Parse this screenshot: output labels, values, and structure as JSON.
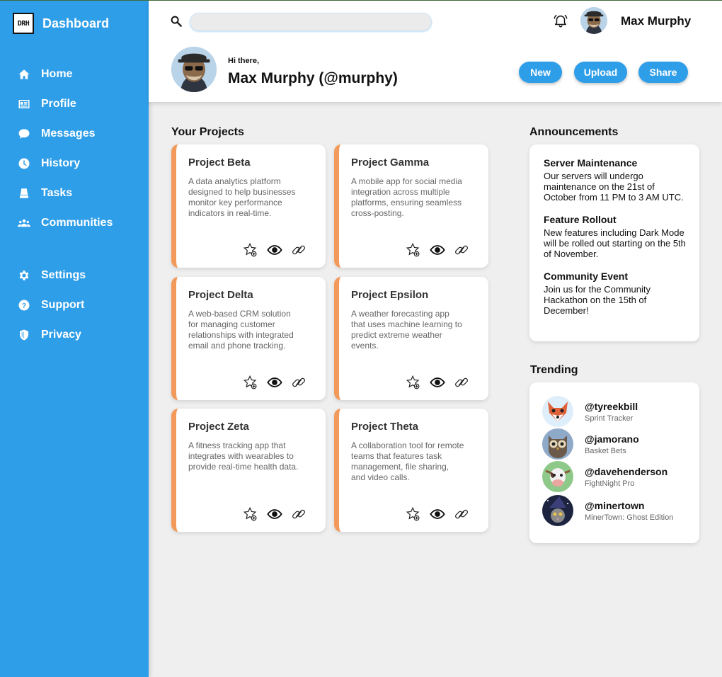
{
  "sidebar": {
    "logo": "DRH",
    "title": "Dashboard",
    "main_items": [
      {
        "label": "Home",
        "icon": "home-icon"
      },
      {
        "label": "Profile",
        "icon": "id-card-icon"
      },
      {
        "label": "Messages",
        "icon": "chat-bubble-icon"
      },
      {
        "label": "History",
        "icon": "clock-icon"
      },
      {
        "label": "Tasks",
        "icon": "tasks-icon"
      },
      {
        "label": "Communities",
        "icon": "people-icon"
      }
    ],
    "secondary_items": [
      {
        "label": "Settings",
        "icon": "gear-icon"
      },
      {
        "label": "Support",
        "icon": "help-icon"
      },
      {
        "label": "Privacy",
        "icon": "shield-icon"
      }
    ]
  },
  "header": {
    "search_placeholder": "",
    "search_value": "",
    "user_name": "Max Murphy",
    "greeting": "Hi there,",
    "handle": "Max Murphy (@murphy)",
    "buttons": {
      "new": "New",
      "upload": "Upload",
      "share": "Share"
    }
  },
  "projects": {
    "title": "Your Projects",
    "items": [
      {
        "name": "Project Beta",
        "description": "A data analytics platform designed to help businesses monitor key performance indicators in real-time."
      },
      {
        "name": "Project Gamma",
        "description": "A mobile app for social media integration across multiple platforms, ensuring seamless cross-posting."
      },
      {
        "name": "Project Delta",
        "description": "A web-based CRM solution for managing customer relationships with integrated email and phone tracking."
      },
      {
        "name": "Project Epsilon",
        "description": "A weather forecasting app that uses machine learning to predict extreme weather events."
      },
      {
        "name": "Project Zeta",
        "description": "A fitness tracking app that integrates with wearables to provide real-time health data."
      },
      {
        "name": "Project Theta",
        "description": "A collaboration tool for remote teams that features task management, file sharing, and video calls."
      }
    ]
  },
  "announcements": {
    "title": "Announcements",
    "items": [
      {
        "title": "Server Maintenance",
        "body": "Our servers will undergo maintenance on the 21st of October from 11 PM to 3 AM UTC."
      },
      {
        "title": "Feature Rollout",
        "body": "New features including Dark Mode will be rolled out starting on the 5th of November."
      },
      {
        "title": "Community Event",
        "body": "Join us for the Community Hackathon on the 15th of December!"
      }
    ]
  },
  "trending": {
    "title": "Trending",
    "items": [
      {
        "user": "@tyreekbill",
        "project": "Sprint Tracker"
      },
      {
        "user": "@jamorano",
        "project": "Basket Bets"
      },
      {
        "user": "@davehenderson",
        "project": "FightNight Pro"
      },
      {
        "user": "@minertown",
        "project": "MinerTown: Ghost Edition"
      }
    ]
  },
  "colors": {
    "sidebar": "#2f9ee9",
    "accent": "#2f9ee9",
    "card_border": "#f29a5b",
    "background": "#efefef"
  }
}
